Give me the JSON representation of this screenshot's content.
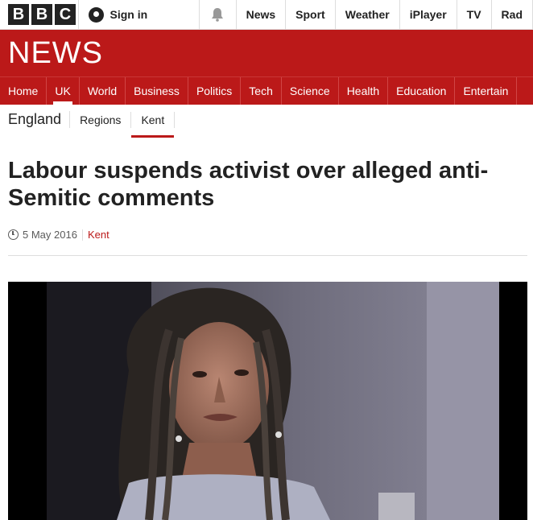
{
  "topbar": {
    "logo_letters": [
      "B",
      "B",
      "C"
    ],
    "signin_label": "Sign in",
    "nav": [
      "News",
      "Sport",
      "Weather",
      "iPlayer",
      "TV",
      "Rad"
    ]
  },
  "banner": {
    "title": "NEWS"
  },
  "mainnav": {
    "items": [
      "Home",
      "UK",
      "World",
      "Business",
      "Politics",
      "Tech",
      "Science",
      "Health",
      "Education",
      "Entertain"
    ],
    "active": "UK"
  },
  "subnav": {
    "section": "England",
    "items": [
      "Regions",
      "Kent"
    ],
    "active": "Kent"
  },
  "article": {
    "headline": "Labour suspends activist over alleged anti-Semitic comments",
    "date": "5 May 2016",
    "tag": "Kent"
  },
  "colors": {
    "brand_red": "#bb1919",
    "text": "#222222"
  }
}
